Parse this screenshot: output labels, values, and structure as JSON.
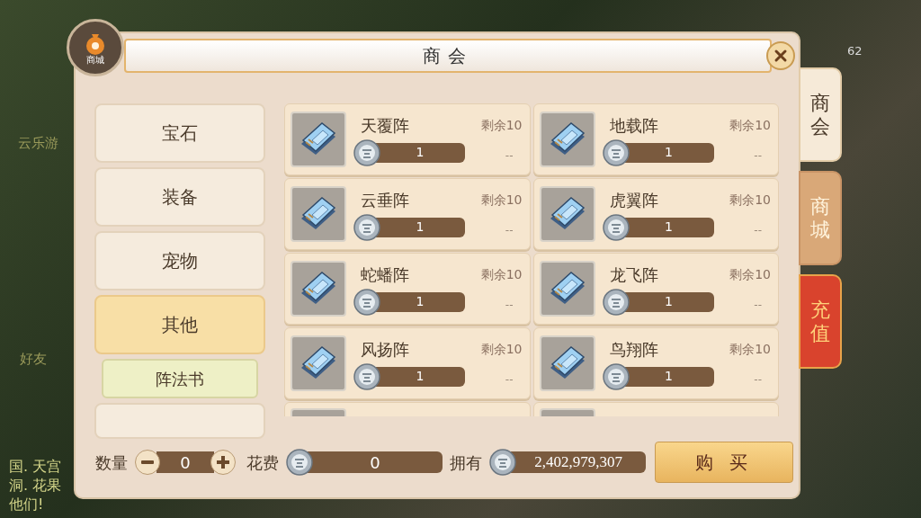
{
  "header": {
    "title": "商会",
    "badge": "商城"
  },
  "categories": [
    {
      "label": "宝石",
      "selected": false
    },
    {
      "label": "装备",
      "selected": false
    },
    {
      "label": "宠物",
      "selected": false
    },
    {
      "label": "其他",
      "selected": true,
      "children": [
        {
          "label": "阵法书",
          "selected": true
        }
      ]
    }
  ],
  "items": [
    {
      "name": "天覆阵",
      "remaining": "剩余10",
      "price": "1",
      "limit": "--"
    },
    {
      "name": "地载阵",
      "remaining": "剩余10",
      "price": "1",
      "limit": "--"
    },
    {
      "name": "云垂阵",
      "remaining": "剩余10",
      "price": "1",
      "limit": "--"
    },
    {
      "name": "虎翼阵",
      "remaining": "剩余10",
      "price": "1",
      "limit": "--"
    },
    {
      "name": "蛇蟠阵",
      "remaining": "剩余10",
      "price": "1",
      "limit": "--"
    },
    {
      "name": "龙飞阵",
      "remaining": "剩余10",
      "price": "1",
      "limit": "--"
    },
    {
      "name": "风扬阵",
      "remaining": "剩余10",
      "price": "1",
      "limit": "--"
    },
    {
      "name": "鸟翔阵",
      "remaining": "剩余10",
      "price": "1",
      "limit": "--"
    }
  ],
  "side_tabs": [
    {
      "label": "商会",
      "selected": true,
      "kind": "plain"
    },
    {
      "label": "商城",
      "selected": false,
      "kind": "plain"
    },
    {
      "label": "充值",
      "selected": false,
      "kind": "promo"
    }
  ],
  "footer": {
    "quantity_label": "数量",
    "quantity": "0",
    "cost_label": "花费",
    "cost": "0",
    "owned_label": "拥有",
    "owned": "2,402,979,307",
    "buy_button": "购 买"
  },
  "background": {
    "labels": [
      "云乐游",
      "好友"
    ],
    "level": "62",
    "chat": [
      "国. 天宫",
      "洞. 花果",
      "他们!"
    ]
  }
}
